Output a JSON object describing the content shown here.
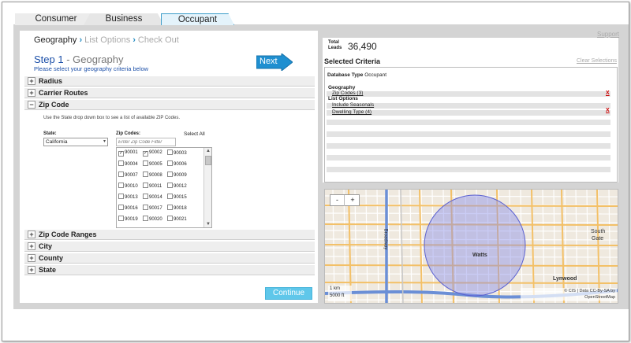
{
  "tabs": [
    {
      "label": "Consumer"
    },
    {
      "label": "Business"
    },
    {
      "label": "Occupant",
      "active": true
    }
  ],
  "breadcrumb": {
    "step1": "Geography",
    "step2": "List Options",
    "step3": "Check Out"
  },
  "step": {
    "title_num": "Step 1",
    "title_sep": " - ",
    "title_name": "Geography",
    "subtitle": "Please select your geography criteria below"
  },
  "next_button": "Next",
  "sections": [
    {
      "label": "Radius",
      "expanded": false
    },
    {
      "label": "Carrier Routes",
      "expanded": false
    },
    {
      "label": "Zip Code",
      "expanded": true
    },
    {
      "label": "Zip Code Ranges",
      "expanded": false
    },
    {
      "label": "City",
      "expanded": false
    },
    {
      "label": "County",
      "expanded": false
    },
    {
      "label": "State",
      "expanded": false
    }
  ],
  "zip_panel": {
    "help_text": "Use the State drop down box to see a list of available ZIP Codes.",
    "state_label": "State:",
    "state_value": "California",
    "zip_label": "Zip Codes:",
    "select_all": "Select All",
    "filter_placeholder": "Enter Zip Code Filter",
    "codes": [
      {
        "code": "90001",
        "checked": true
      },
      {
        "code": "90002",
        "checked": true
      },
      {
        "code": "90003",
        "checked": false
      },
      {
        "code": "90004",
        "checked": false
      },
      {
        "code": "90005",
        "checked": false
      },
      {
        "code": "90006",
        "checked": false
      },
      {
        "code": "90007",
        "checked": false
      },
      {
        "code": "90008",
        "checked": false
      },
      {
        "code": "90009",
        "checked": false
      },
      {
        "code": "90010",
        "checked": false
      },
      {
        "code": "90011",
        "checked": false
      },
      {
        "code": "90012",
        "checked": false
      },
      {
        "code": "90013",
        "checked": false
      },
      {
        "code": "90014",
        "checked": false
      },
      {
        "code": "90015",
        "checked": false
      },
      {
        "code": "90016",
        "checked": false
      },
      {
        "code": "90017",
        "checked": false
      },
      {
        "code": "90018",
        "checked": false
      },
      {
        "code": "90019",
        "checked": false
      },
      {
        "code": "90020",
        "checked": false
      },
      {
        "code": "90021",
        "checked": false
      }
    ]
  },
  "continue_button": "Continue",
  "support_link": "Support",
  "total_leads": {
    "label_line1": "Total",
    "label_line2": "Leads",
    "value": "36,490"
  },
  "selected_criteria": {
    "title": "Selected Criteria",
    "clear": "Clear Selections",
    "db_type_label": "Database Type",
    "db_type_value": "Occupant",
    "geo_head": "Geography",
    "geo_item": "Zip Codes (3)",
    "list_head": "List Options",
    "list_item1": "Include Seasonals",
    "list_item2": "Dwelling Type (4)",
    "remove": "X"
  },
  "map": {
    "zoom_out": "-",
    "zoom_in": "+",
    "labels": {
      "watts": "Watts",
      "south_gate_1": "South",
      "south_gate_2": "Gate",
      "lynwood": "Lynwood",
      "broadway": "Broadway"
    },
    "scale_km": "1 km",
    "scale_ft": "5000 ft",
    "attribution1": "© CIS | Data CC-By-SA by",
    "attribution2": "OpenStreetMap",
    "circle_color": "#8a8ee8",
    "freeway_color": "#6b8fd6",
    "arterial_color": "#f3c067"
  }
}
